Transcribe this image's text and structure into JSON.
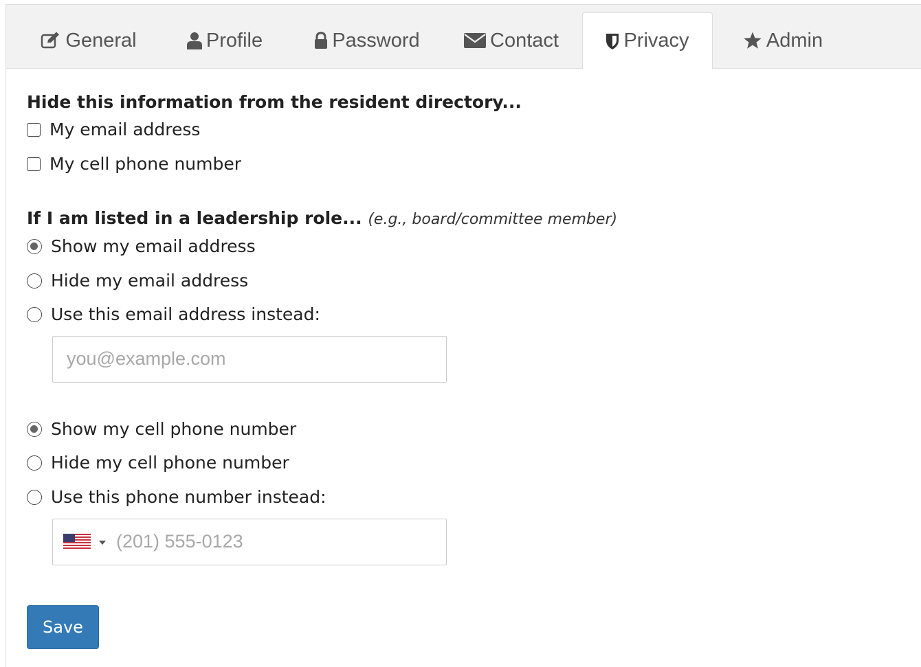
{
  "tabs": [
    {
      "label": "General",
      "icon": "edit-icon"
    },
    {
      "label": "Profile",
      "icon": "user-icon"
    },
    {
      "label": "Password",
      "icon": "lock-icon"
    },
    {
      "label": "Contact",
      "icon": "envelope-icon"
    },
    {
      "label": "Privacy",
      "icon": "shield-icon",
      "active": true
    },
    {
      "label": "Admin",
      "icon": "star-icon"
    }
  ],
  "directory": {
    "heading": "Hide this information from the resident directory...",
    "options": [
      {
        "label": "My email address",
        "checked": false
      },
      {
        "label": "My cell phone number",
        "checked": false
      }
    ]
  },
  "leadership": {
    "heading": "If I am listed in a leadership role...",
    "note": "(e.g., board/committee member)",
    "email_options": [
      {
        "label": "Show my email address",
        "selected": true
      },
      {
        "label": "Hide my email address",
        "selected": false
      },
      {
        "label": "Use this email address instead:",
        "selected": false
      }
    ],
    "email_placeholder": "you@example.com",
    "phone_options": [
      {
        "label": "Show my cell phone number",
        "selected": true
      },
      {
        "label": "Hide my cell phone number",
        "selected": false
      },
      {
        "label": "Use this phone number instead:",
        "selected": false
      }
    ],
    "phone_placeholder": "(201) 555-0123",
    "phone_country": "us-flag-icon"
  },
  "save_label": "Save",
  "colors": {
    "primary": "#337ab7",
    "tab_bar": "#f2f2f2",
    "border": "#dddddd"
  }
}
